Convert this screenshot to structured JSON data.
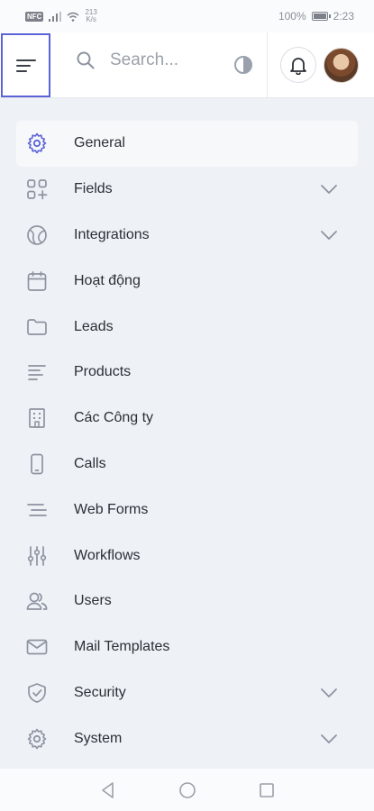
{
  "status_bar": {
    "chip": "NFC",
    "speed": "213",
    "speed_unit": "K/s",
    "battery": "100%",
    "time": "2:23"
  },
  "header": {
    "search_placeholder": "Search..."
  },
  "menu": {
    "items": [
      {
        "label": "General",
        "icon": "gear-icon",
        "expandable": false,
        "active": true
      },
      {
        "label": "Fields",
        "icon": "grid-plus-icon",
        "expandable": true
      },
      {
        "label": "Integrations",
        "icon": "globe-icon",
        "expandable": true
      },
      {
        "label": "Hoạt động",
        "icon": "calendar-icon",
        "expandable": false
      },
      {
        "label": "Leads",
        "icon": "folder-icon",
        "expandable": false
      },
      {
        "label": "Products",
        "icon": "lines-icon",
        "expandable": false
      },
      {
        "label": "Các Công ty",
        "icon": "building-icon",
        "expandable": false
      },
      {
        "label": "Calls",
        "icon": "phone-icon",
        "expandable": false
      },
      {
        "label": "Web Forms",
        "icon": "list-icon",
        "expandable": false
      },
      {
        "label": "Workflows",
        "icon": "sliders-icon",
        "expandable": false
      },
      {
        "label": "Users",
        "icon": "users-icon",
        "expandable": false
      },
      {
        "label": "Mail Templates",
        "icon": "mail-icon",
        "expandable": false
      },
      {
        "label": "Security",
        "icon": "shield-icon",
        "expandable": true
      },
      {
        "label": "System",
        "icon": "gear-icon",
        "expandable": true
      }
    ]
  },
  "colors": {
    "accent": "#5b63d6",
    "icon": "#8d93a0",
    "background": "#eef1f6"
  }
}
